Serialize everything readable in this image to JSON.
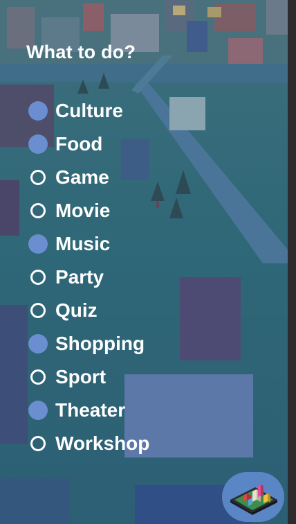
{
  "panel": {
    "title": "What to do?"
  },
  "options": [
    {
      "label": "Culture",
      "selected": true
    },
    {
      "label": "Food",
      "selected": true
    },
    {
      "label": "Game",
      "selected": false
    },
    {
      "label": "Movie",
      "selected": false
    },
    {
      "label": "Music",
      "selected": true
    },
    {
      "label": "Party",
      "selected": false
    },
    {
      "label": "Quiz",
      "selected": false
    },
    {
      "label": "Shopping",
      "selected": true
    },
    {
      "label": "Sport",
      "selected": false
    },
    {
      "label": "Theater",
      "selected": true
    },
    {
      "label": "Workshop",
      "selected": false
    }
  ],
  "colors": {
    "selected_radio": "#6a8ecf",
    "unselected_radio_border": "#ffffff",
    "text": "#ffffff",
    "app_button": "#5b86c6",
    "scene_base": "#2f6a78"
  },
  "icons": {
    "app_button": "city-map-icon"
  }
}
